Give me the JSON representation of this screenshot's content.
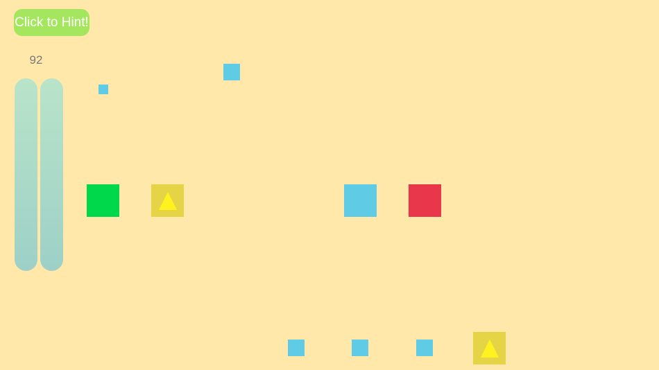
{
  "colors": {
    "background": "#ffe8a9",
    "hint_button": "#a4e65e",
    "green_tile": "#00d84b",
    "blue_tile": "#5fcbe4",
    "red_tile": "#e8364a",
    "yellow_tile": "#e5d446",
    "triangle": "#fff21e"
  },
  "hint_button": {
    "label": "Click to Hint!"
  },
  "score": {
    "value": "92"
  },
  "meters": [
    {
      "name": "meter-left",
      "level": 1.0
    },
    {
      "name": "meter-right",
      "level": 1.0
    }
  ],
  "tiles": [
    {
      "name": "blue-square-small",
      "color": "blue_tile",
      "shape": "square"
    },
    {
      "name": "blue-square-top",
      "color": "blue_tile",
      "shape": "square"
    },
    {
      "name": "green-square",
      "color": "green_tile",
      "shape": "square"
    },
    {
      "name": "yellow-triangle-tile",
      "color": "yellow_tile",
      "shape": "triangle"
    },
    {
      "name": "blue-square-large",
      "color": "blue_tile",
      "shape": "square"
    },
    {
      "name": "red-square",
      "color": "red_tile",
      "shape": "square"
    },
    {
      "name": "blue-square-bottom-1",
      "color": "blue_tile",
      "shape": "square"
    },
    {
      "name": "blue-square-bottom-2",
      "color": "blue_tile",
      "shape": "square"
    },
    {
      "name": "blue-square-bottom-3",
      "color": "blue_tile",
      "shape": "square"
    },
    {
      "name": "yellow-triangle-tile-bottom",
      "color": "yellow_tile",
      "shape": "triangle"
    }
  ]
}
